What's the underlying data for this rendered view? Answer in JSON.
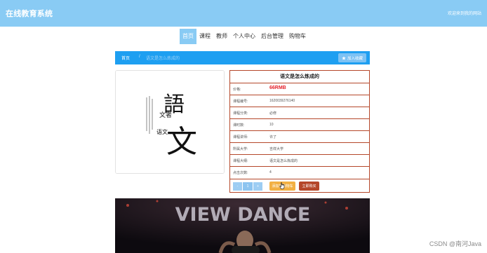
{
  "header": {
    "site_title": "在线教育系统",
    "welcome": "欢迎来到我的网站"
  },
  "nav": {
    "items": [
      "首页",
      "课程",
      "教师",
      "个人中心",
      "后台管理",
      "购物车"
    ],
    "active_index": 0
  },
  "breadcrumb": {
    "home": "首页",
    "separator": "/",
    "current": "语文是怎么炼成的"
  },
  "favorite_button": {
    "label": "加入收藏"
  },
  "course_image": {
    "big_chars": [
      "語",
      "文"
    ],
    "side_text": "文者",
    "side_text2": "语文"
  },
  "course": {
    "title": "语文是怎么炼成的",
    "rows": [
      {
        "label": "价格:",
        "value": "66RMB",
        "is_price": true
      },
      {
        "label": "课程编号:",
        "value": "1620039276140"
      },
      {
        "label": "课程分类:",
        "value": "必修"
      },
      {
        "label": "课时数:",
        "value": "10"
      },
      {
        "label": "课程讲师:",
        "value": "许了"
      },
      {
        "label": "所属大学:",
        "value": "吉祥大学"
      },
      {
        "label": "课程大纲:",
        "value": "语文是怎么炼成的"
      },
      {
        "label": "点击次数:",
        "value": "4"
      }
    ]
  },
  "purchase": {
    "minus": "-",
    "quantity": "1",
    "plus": "+",
    "add_to_cart": "添加到购物车",
    "buy_now": "立即购买"
  },
  "video": {
    "banner_text": "VIEW DANCE"
  },
  "watermark": "CSDN @南河Java",
  "colors": {
    "header_bg": "#89cbf4",
    "breadcrumb_bg": "#1e9ff1",
    "price": "#e4222b",
    "border_accent": "#b5472a",
    "cart_button": "#f2b043",
    "buy_button": "#b5472a"
  }
}
